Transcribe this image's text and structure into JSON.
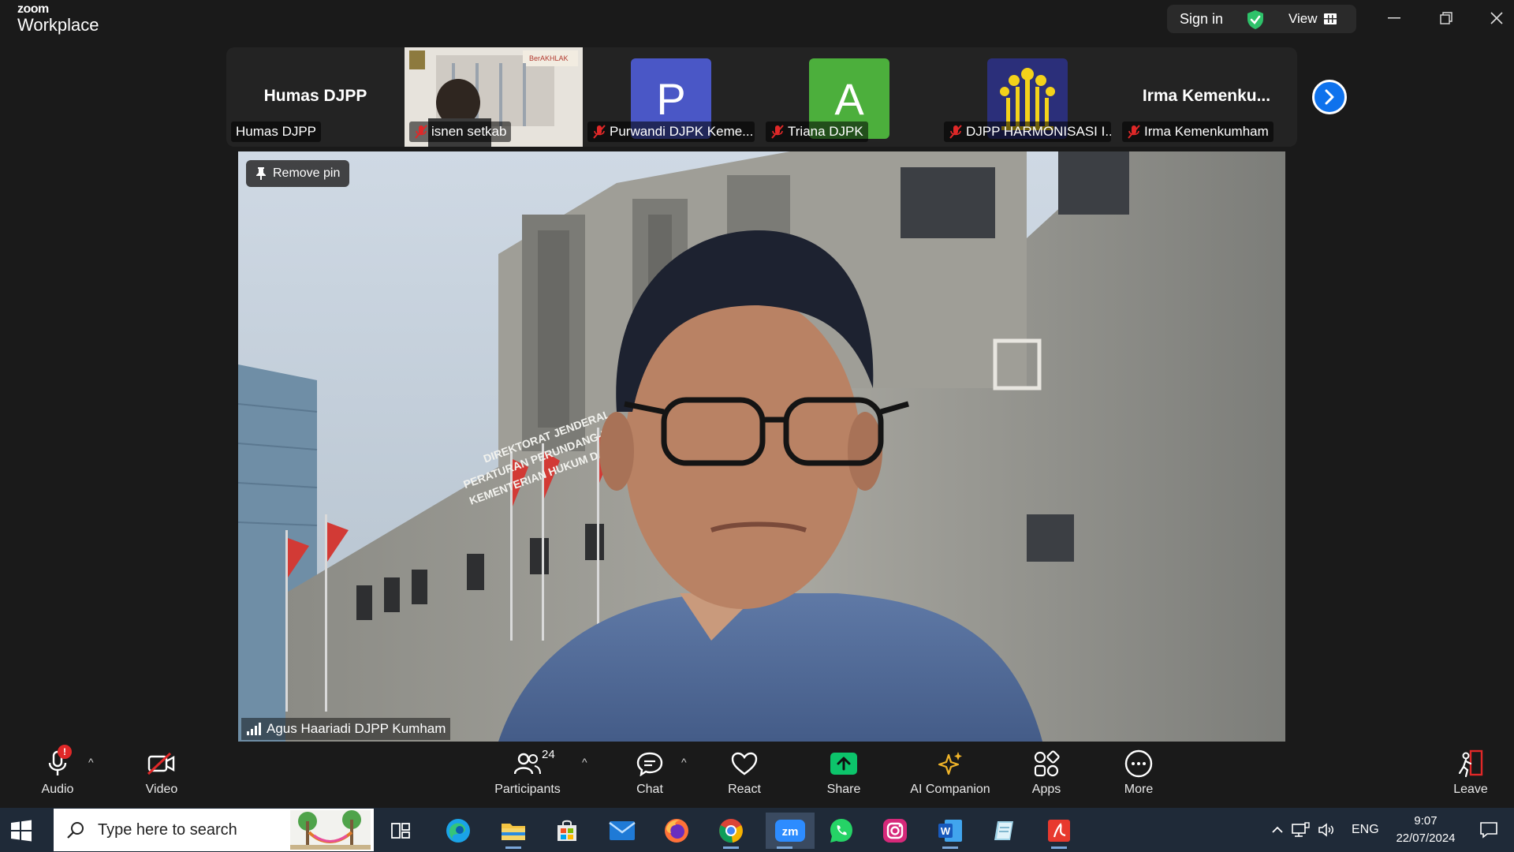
{
  "app": {
    "brand_small": "zoom",
    "brand_large": "Workplace"
  },
  "titlebar": {
    "signin_label": "Sign in",
    "view_label": "View"
  },
  "filmstrip": {
    "tiles": [
      {
        "big_name": "Humas DJPP",
        "label": "Humas DJPP",
        "muted": false
      },
      {
        "label": "isnen setkab",
        "muted": true
      },
      {
        "avatar_letter": "P",
        "label": "Purwandi DJPK Keme...",
        "muted": true,
        "color": "#4a57c6"
      },
      {
        "avatar_letter": "A",
        "label": "Triana DJPK",
        "muted": true,
        "color": "#4caf3c"
      },
      {
        "label": "DJPP HARMONISASI I...",
        "muted": true
      },
      {
        "big_name": "Irma  Kemenku...",
        "label": "Irma Kemenkumham",
        "muted": true
      }
    ]
  },
  "main_video": {
    "remove_pin_label": "Remove pin",
    "speaker_name": "Agus Haariadi DJPP Kumham",
    "building_sign": [
      "DIREKTORAT JENDERAL",
      "PERATURAN PERUNDANG-UNDANGAN",
      "KEMENTERIAN HUKUM DAN HAM RI"
    ]
  },
  "toolbar": {
    "audio": "Audio",
    "audio_badge": "!",
    "video": "Video",
    "participants": "Participants",
    "participants_count": "24",
    "chat": "Chat",
    "react": "React",
    "share": "Share",
    "ai_companion": "AI Companion",
    "apps": "Apps",
    "more": "More",
    "leave": "Leave"
  },
  "taskbar": {
    "search_placeholder": "Type here to search",
    "language": "ENG",
    "time": "9:07",
    "date": "22/07/2024"
  },
  "colors": {
    "accent": "#0e72ed",
    "share_green": "#0cc46b",
    "mute_red": "#e02828"
  }
}
